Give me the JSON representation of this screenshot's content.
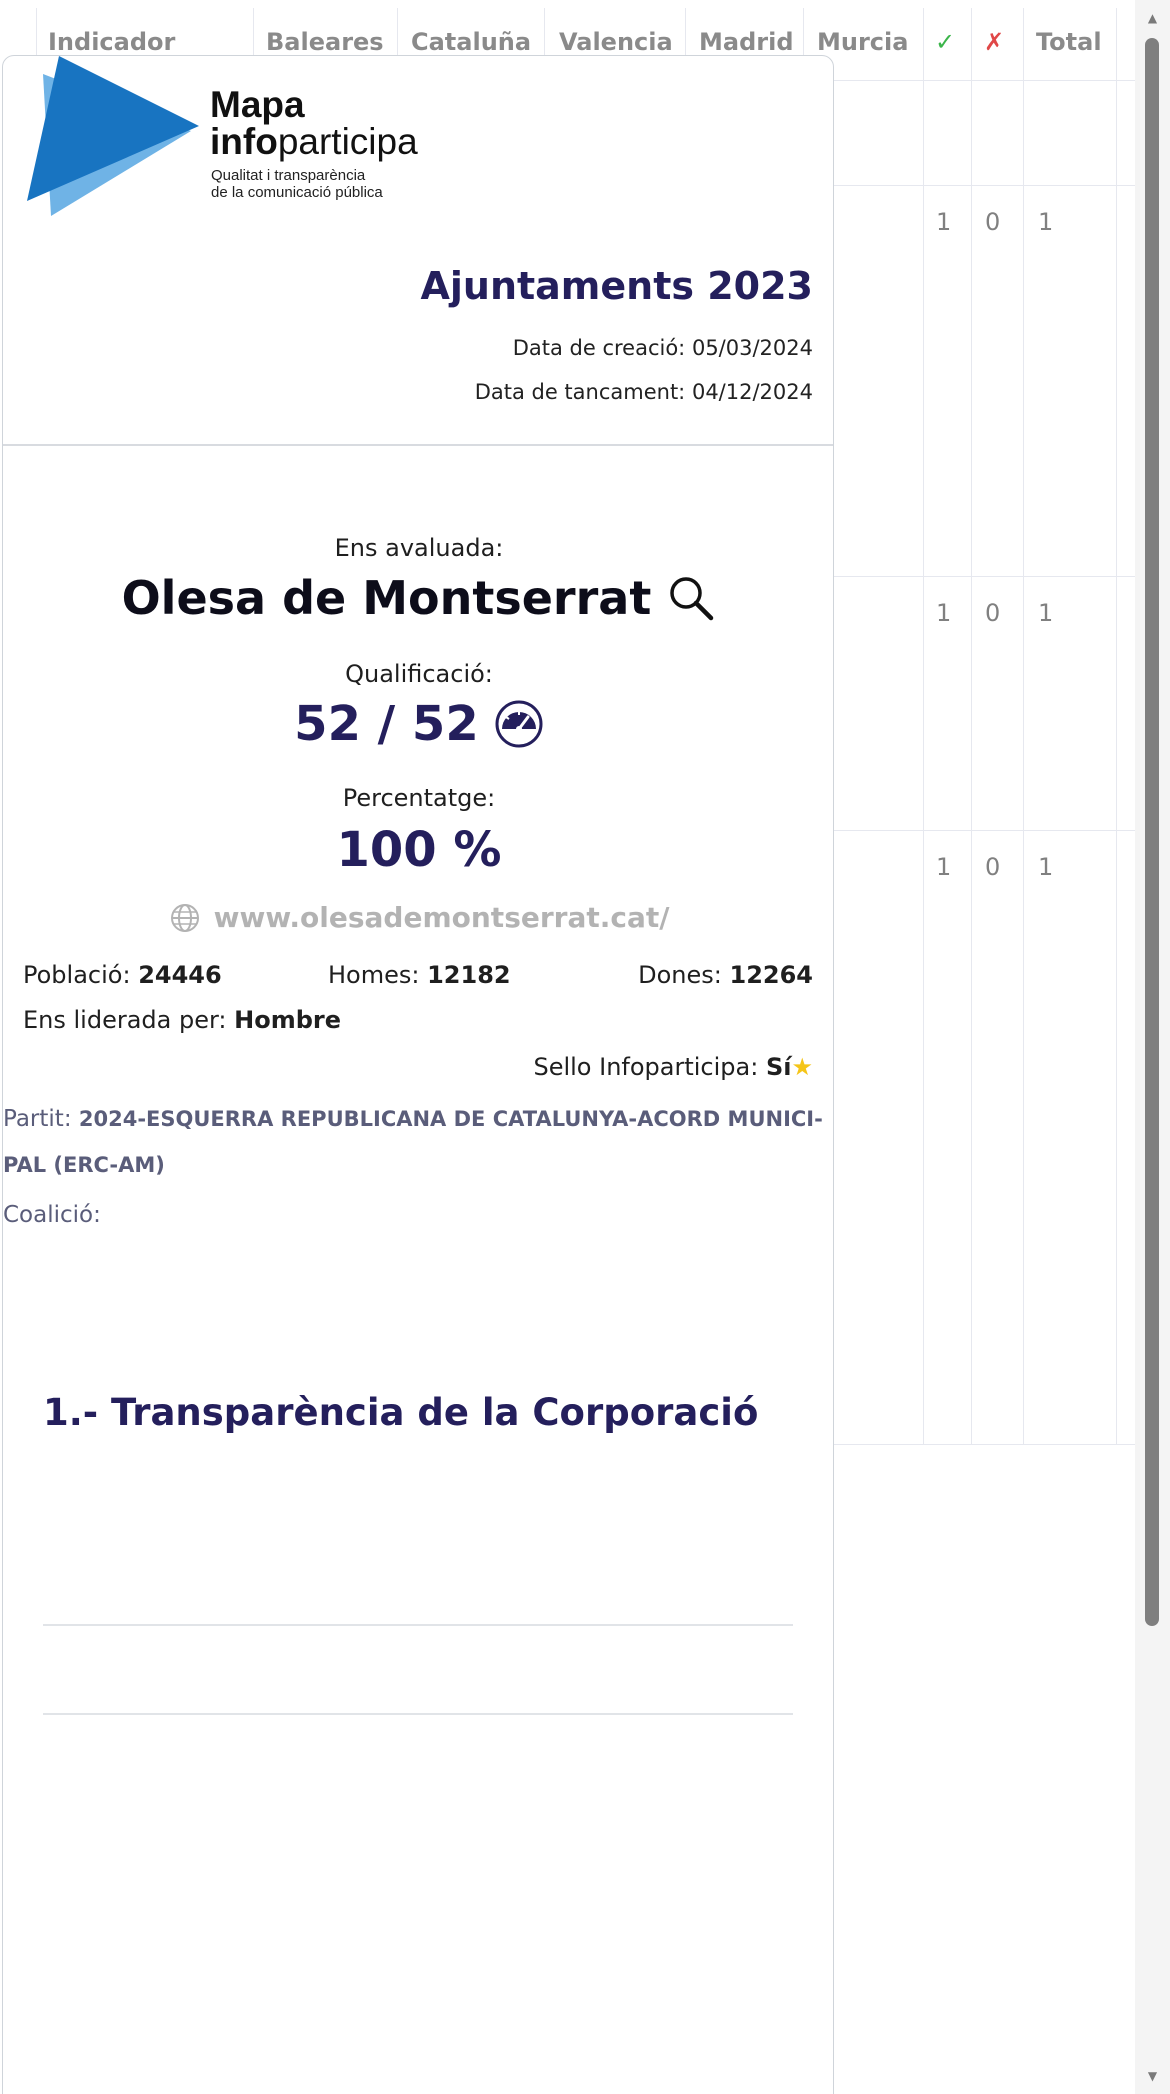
{
  "table": {
    "headers": [
      "Indicador",
      "Baleares",
      "Cataluña",
      "Valencia",
      "Madrid",
      "Murcia",
      "✓",
      "✗",
      "Total"
    ],
    "rows": [
      {
        "check": "1",
        "cross": "0",
        "total": "1"
      },
      {
        "check": "1",
        "cross": "0",
        "total": "1"
      },
      {
        "check": "1",
        "cross": "0",
        "total": "1"
      }
    ]
  },
  "logo": {
    "word1": "Mapa",
    "word2_bold": "info",
    "word2_rest": "participa",
    "tagline1": "Qualitat i transparència",
    "tagline2": "de la comunicació pública"
  },
  "report": {
    "title": "Ajuntaments 2023",
    "created_label": "Data de creació:",
    "created": "05/03/2024",
    "closed_label": "Data de tancament:",
    "closed": "04/12/2024"
  },
  "entity": {
    "label": "Ens avaluada:",
    "name": "Olesa de Montserrat",
    "score_label": "Qualificació:",
    "score": "52 / 52",
    "percent_label": "Percentatge:",
    "percent": "100 %",
    "website": "www.olesademontserrat.cat/"
  },
  "stats": {
    "population_label": "Població:",
    "population": "24446",
    "men_label": "Homes:",
    "men": "12182",
    "women_label": "Dones:",
    "women": "12264",
    "leader_label": "Ens liderada per:",
    "leader": "Hombre",
    "seal_label": "Sello Infoparticipa:",
    "seal": "Sí",
    "seal_icon": "star-icon"
  },
  "party": {
    "label": "Partit:",
    "value": "2024-ESQUERRA REPUBLICANA DE CATALUNYA-ACORD MUNICI-PAL (ERC-AM)",
    "coalition_label": "Coalició:"
  },
  "section": {
    "title": "1.- Transparència de la Corporació"
  },
  "colors": {
    "accent": "#241f5c",
    "logo_blue": "#1874c1",
    "logo_light": "#6fb3e6",
    "check": "#3bb54a",
    "cross": "#e04848"
  }
}
